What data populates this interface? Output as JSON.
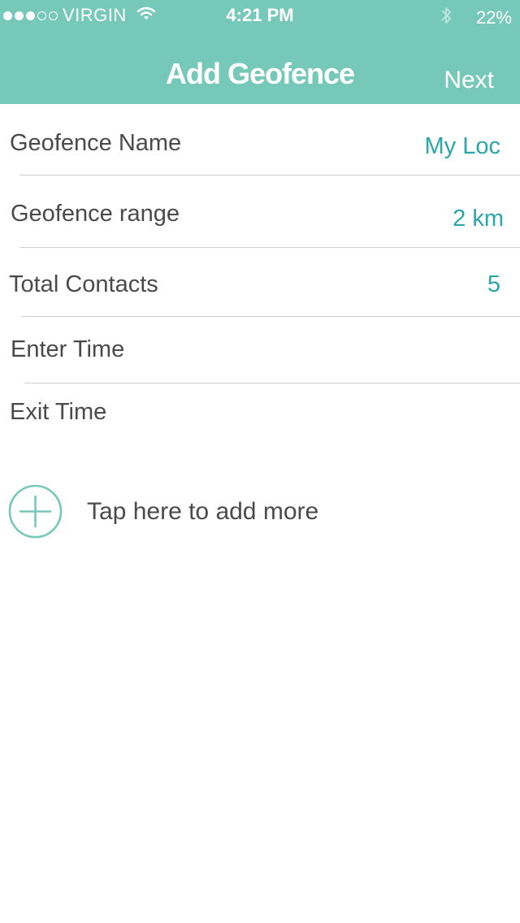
{
  "status_bar": {
    "carrier": "VIRGIN",
    "time": "4:21 PM",
    "battery": "22%",
    "signal_dots_filled": 3,
    "signal_dots_total": 5
  },
  "nav": {
    "title": "Add Geofence",
    "next_label": "Next"
  },
  "fields": [
    {
      "label": "Geofence Name",
      "value": "My Loc"
    },
    {
      "label": "Geofence range",
      "value": "2 km"
    },
    {
      "label": "Total Contacts",
      "value": "5"
    },
    {
      "label": "Enter Time",
      "value": ""
    },
    {
      "label": "Exit Time",
      "value": ""
    }
  ],
  "add_more": {
    "label": "Tap here to add more",
    "icon": "plus-circle-icon"
  },
  "colors": {
    "header": "#76c9b8",
    "accent_value": "#2aa6a8",
    "label_text": "#4a4a4a"
  }
}
